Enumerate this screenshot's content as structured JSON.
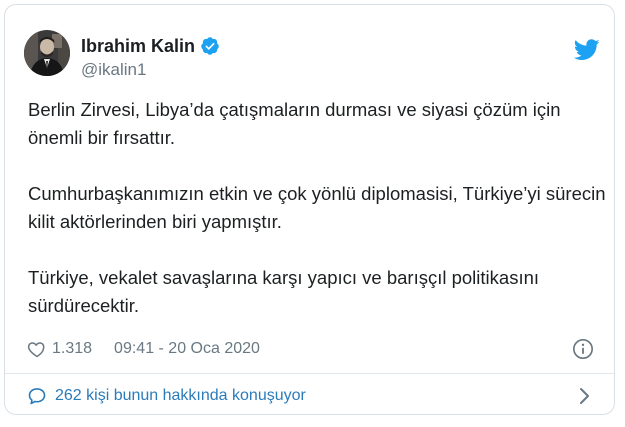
{
  "author": {
    "name": "Ibrahim Kalin",
    "handle": "@ikalin1"
  },
  "tweet": {
    "paragraphs": [
      "Berlin Zirvesi, Libya’da çatışmaların durması ve siyasi çözüm için önemli bir fırsattır.",
      "Cumhurbaşkanımızın etkin ve çok yönlü diplomasisi, Türkiye’yi sürecin kilit aktörlerinden biri yapmıştır.",
      "Türkiye, vekalet savaşlarına karşı yapıcı ve barışçıl politikasını sürdürecektir."
    ]
  },
  "meta": {
    "likes": "1.318",
    "timestamp": "09:41 - 20 Oca 2020"
  },
  "conversation": {
    "label": "262 kişi bunun hakkında konuşuyor"
  },
  "icons": {
    "verified": "verified-badge-icon",
    "brand": "twitter-bird-icon",
    "like": "heart-icon",
    "info": "info-icon",
    "reply": "speech-bubble-icon",
    "chevron": "chevron-right-icon"
  },
  "colors": {
    "brand_blue": "#1da1f2",
    "link_blue": "#2b7bb9",
    "text": "#1c2022",
    "muted": "#697882",
    "border": "#d8e0e6"
  }
}
